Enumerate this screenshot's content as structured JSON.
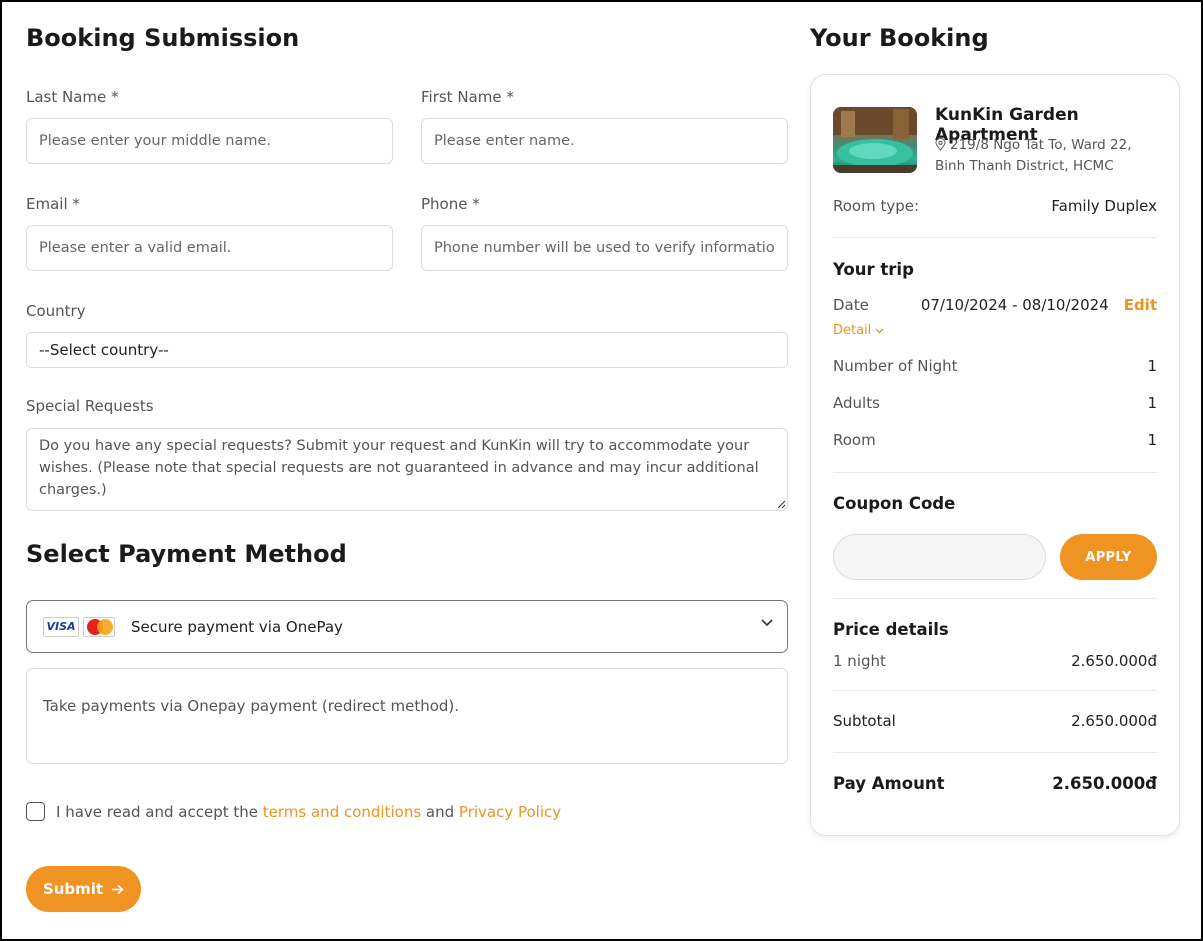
{
  "form": {
    "title": "Booking Submission",
    "last_name": {
      "label": "Last Name",
      "placeholder": "Please enter your middle name."
    },
    "first_name": {
      "label": "First Name",
      "placeholder": "Please enter name."
    },
    "email": {
      "label": "Email",
      "placeholder": "Please enter a valid email."
    },
    "phone": {
      "label": "Phone",
      "placeholder": "Phone number will be used to verify information"
    },
    "country": {
      "label": "Country",
      "selected": "--Select country--"
    },
    "special_requests": {
      "label": "Special Requests",
      "placeholder": "Do you have any special requests? Submit your request and KunKin will try to accommodate your wishes. (Please note that special requests are not guaranteed in advance and may incur additional charges.)"
    }
  },
  "payment": {
    "title": "Select Payment Method",
    "visa_text": "VISA",
    "method_label": "Secure payment via OnePay",
    "description": "Take payments via Onepay payment (redirect method)."
  },
  "terms": {
    "prefix": "I have read and accept the ",
    "terms_link": "terms and conditions",
    "middle": " and ",
    "privacy_link": "Privacy Policy",
    "checked": false
  },
  "submit": {
    "label": "Submit"
  },
  "booking": {
    "title": "Your Booking",
    "hotel_name": "KunKin Garden Apartment",
    "address": "219/8 Ngo Tat To, Ward 22, Binh Thanh District, HCMC",
    "room_type_label": "Room type:",
    "room_type_value": "Family Duplex",
    "trip_title": "Your trip",
    "date_label": "Date",
    "date_value": "07/10/2024 - 08/10/2024",
    "edit_label": "Edit",
    "detail_label": "Detail",
    "nights_label": "Number of Night",
    "nights_value": "1",
    "adults_label": "Adults",
    "adults_value": "1",
    "room_label": "Room",
    "room_value": "1",
    "coupon_title": "Coupon Code",
    "apply_label": "APPLY",
    "price_title": "Price details",
    "night_line_label": "1 night",
    "night_line_value": "2.650.000đ",
    "subtotal_label": "Subtotal",
    "subtotal_value": "2.650.000đ",
    "pay_label": "Pay Amount",
    "pay_value": "2.650.000đ"
  },
  "colors": {
    "accent": "#ef9322",
    "text": "#222222",
    "border": "#dcdcdc"
  }
}
